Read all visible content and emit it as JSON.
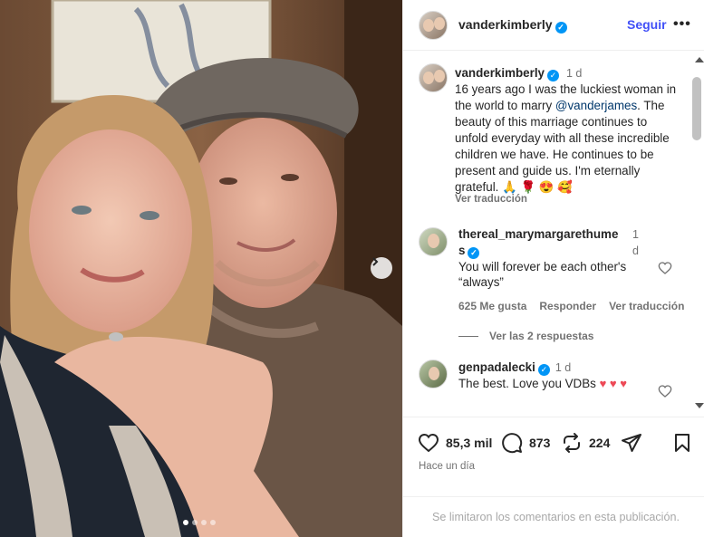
{
  "post": {
    "author": "vanderkimberly",
    "follow_label": "Seguir",
    "more_label": "•••",
    "carousel_dots": 4,
    "active_dot": 0
  },
  "caption": {
    "username": "vanderkimberly",
    "time": "1 d",
    "text_before": "16 years ago I was the luckiest woman in the world to marry ",
    "mention": "@vanderjames",
    "text_after": ". The beauty of this marriage continues to unfold everyday with all these incredible children we have.  He continues to be present and guide us. I'm eternally grateful. 🙏 🌹 😍 🥰",
    "see_translation": "Ver traducción"
  },
  "comments": [
    {
      "username": "thereal_marymargarethumes",
      "time": "1 d",
      "text": "You will forever be each other's “always”",
      "likes": "625 Me gusta",
      "reply_label": "Responder",
      "translate_label": "Ver traducción",
      "view_replies": "Ver las 2 respuestas"
    },
    {
      "username": "genpadalecki",
      "time": "1 d",
      "text": "The best. Love you VDBs ",
      "hearts": "♥ ♥ ♥"
    }
  ],
  "actions": {
    "likes": "85,3 mil",
    "comments": "873",
    "reposts": "224",
    "time_ago": "Hace un día"
  },
  "footer": {
    "comments_limited": "Se limitaron los comentarios en esta publicación."
  },
  "colors": {
    "verified": "#0095f6",
    "follow": "#4150f7",
    "mention": "#00376b",
    "heart": "#ed4956",
    "muted": "#737373"
  },
  "icons": [
    "verified-icon",
    "chevron-right-icon",
    "heart-icon",
    "comment-icon",
    "repost-icon",
    "share-icon",
    "bookmark-icon"
  ]
}
